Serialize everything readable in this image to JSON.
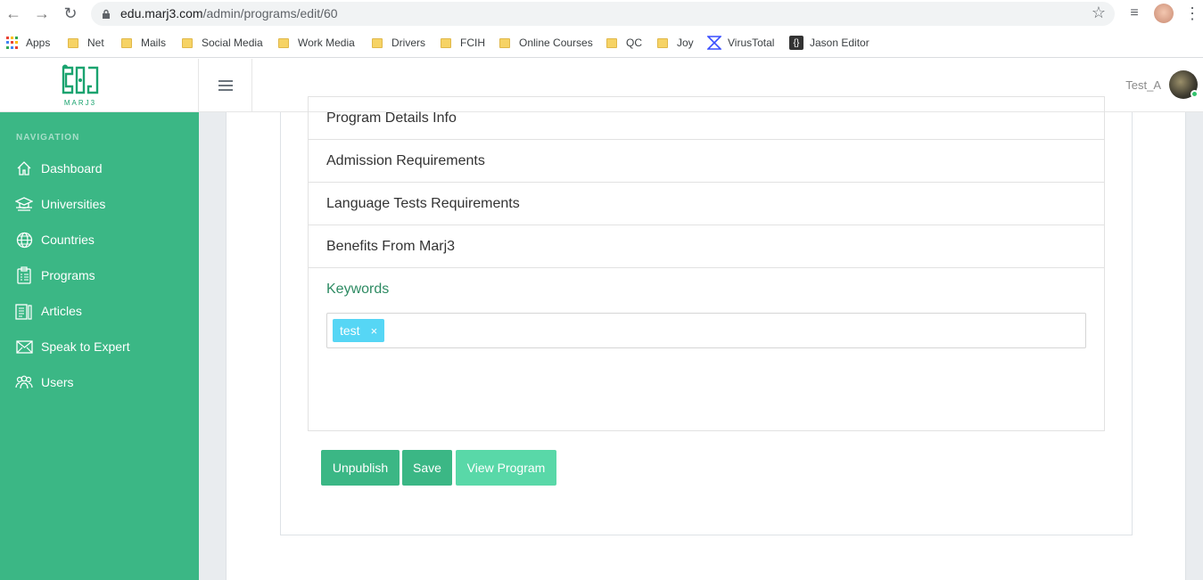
{
  "browser": {
    "url_host": "edu.marj3.com",
    "url_path": "/admin/programs/edit/60",
    "bookmarks": [
      {
        "label": "Apps",
        "type": "apps"
      },
      {
        "label": "Net",
        "type": "folder"
      },
      {
        "label": "Mails",
        "type": "folder"
      },
      {
        "label": "Social Media",
        "type": "folder"
      },
      {
        "label": "Work Media",
        "type": "folder"
      },
      {
        "label": "Drivers",
        "type": "folder"
      },
      {
        "label": "FCIH",
        "type": "folder"
      },
      {
        "label": "Online Courses",
        "type": "folder"
      },
      {
        "label": "QC",
        "type": "folder"
      },
      {
        "label": "Joy",
        "type": "folder"
      },
      {
        "label": "VirusTotal",
        "type": "link"
      },
      {
        "label": "Jason Editor",
        "type": "link"
      }
    ]
  },
  "header": {
    "logo_text": "MARJ3",
    "user_name": "Test_A"
  },
  "sidebar": {
    "heading": "NAVIGATION",
    "items": [
      {
        "label": "Dashboard",
        "icon": "home-icon"
      },
      {
        "label": "Universities",
        "icon": "graduation-cap-icon"
      },
      {
        "label": "Countries",
        "icon": "globe-icon"
      },
      {
        "label": "Programs",
        "icon": "clipboard-icon"
      },
      {
        "label": "Articles",
        "icon": "article-icon"
      },
      {
        "label": "Speak to Expert",
        "icon": "envelope-icon"
      },
      {
        "label": "Users",
        "icon": "users-icon"
      }
    ]
  },
  "accordion": {
    "sections": [
      {
        "label": "Program Details Info"
      },
      {
        "label": "Admission Requirements"
      },
      {
        "label": "Language Tests Requirements"
      },
      {
        "label": "Benefits From Marj3"
      },
      {
        "label": "Keywords"
      }
    ],
    "keywords_tags": [
      "test"
    ],
    "tag_remove": "×"
  },
  "actions": {
    "unpublish": "Unpublish",
    "save": "Save",
    "view_program": "View Program"
  },
  "colors": {
    "sidebar": "#3bb785",
    "accent": "#2e8b63",
    "tag": "#56d6f5",
    "button_light": "#59d8a8"
  }
}
